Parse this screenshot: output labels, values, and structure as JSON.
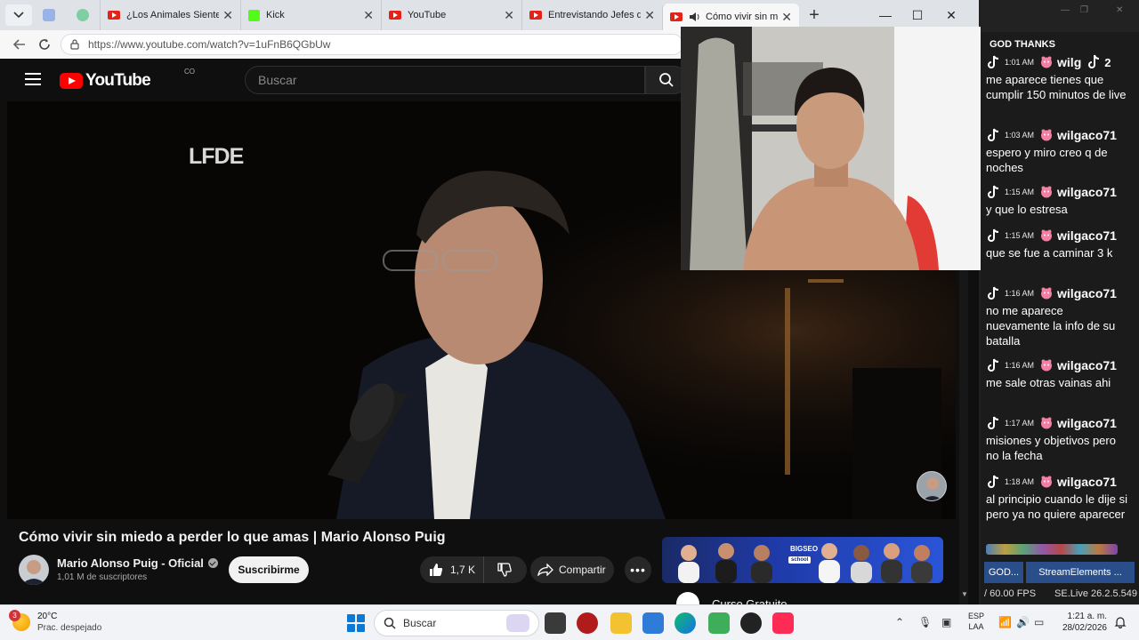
{
  "browser": {
    "tabs": [
      {
        "title": "¿Los Animales Sienten A",
        "favicon": "youtube-icon"
      },
      {
        "title": "Kick",
        "favicon": "kick-icon"
      },
      {
        "title": "YouTube",
        "favicon": "youtube-icon"
      },
      {
        "title": "Entrevistando Jefes de N",
        "favicon": "youtube-icon"
      },
      {
        "title": "Cómo vivir sin miedo",
        "favicon": "youtube-icon",
        "active": true,
        "audio": true
      }
    ],
    "url": "https://www.youtube.com/watch?v=1uFnB6QGbUw"
  },
  "youtube": {
    "logo_text": "YouTube",
    "country_code": "CO",
    "search_placeholder": "Buscar",
    "video": {
      "watermark": "LFDE",
      "title": "Cómo vivir sin miedo a perder lo que amas | Mario Alonso Puig",
      "channel": "Mario Alonso Puig - Oficial",
      "subscribers": "1,01 M de suscriptores",
      "subscribe_label": "Suscribirme",
      "likes": "1,7 K",
      "share_label": "Compartir"
    },
    "ad": {
      "brand": "BIGSEO",
      "sub_brand": "school",
      "title": "Curso Gratuito"
    }
  },
  "chat": {
    "header": "GOD THANKS",
    "messages": [
      {
        "time": "1:01 AM",
        "user": "wilg",
        "gift_count": "2",
        "text": "me aparece tienes que cumplir 150 minutos de live"
      },
      {
        "time": "1:03 AM",
        "user": "wilgaco71",
        "text": "espero y miro creo q de noches"
      },
      {
        "time": "1:15 AM",
        "user": "wilgaco71",
        "text": "y que lo estresa"
      },
      {
        "time": "1:15 AM",
        "user": "wilgaco71",
        "text": "que se fue a caminar 3 k"
      },
      {
        "time": "1:16 AM",
        "user": "wilgaco71",
        "text": "no me aparece nuevamente la info de su batalla"
      },
      {
        "time": "1:16 AM",
        "user": "wilgaco71",
        "text": "me sale otras vainas ahi"
      },
      {
        "time": "1:17 AM",
        "user": "wilgaco71",
        "text": "misiones y objetivos pero no la fecha"
      },
      {
        "time": "1:18 AM",
        "user": "wilgaco71",
        "text": "al principio cuando le dije si pero ya no quiere aparecer"
      }
    ],
    "tabs": [
      "GOD...",
      "StreamElements ..."
    ],
    "fps": "/ 60.00 FPS",
    "version": "SE.Live 26.2.5.549"
  },
  "taskbar": {
    "weather_temp": "20°C",
    "weather_desc": "Prac. despejado",
    "weather_badge": "3",
    "search_placeholder": "Buscar",
    "language_1": "ESP",
    "language_2": "LAA",
    "time": "1:21 a. m.",
    "date": "28/02/2026"
  },
  "colors": {
    "youtube_red": "#ff0000",
    "kick_green": "#53fc18",
    "chat_tab_blue": "#2a4e8a"
  }
}
